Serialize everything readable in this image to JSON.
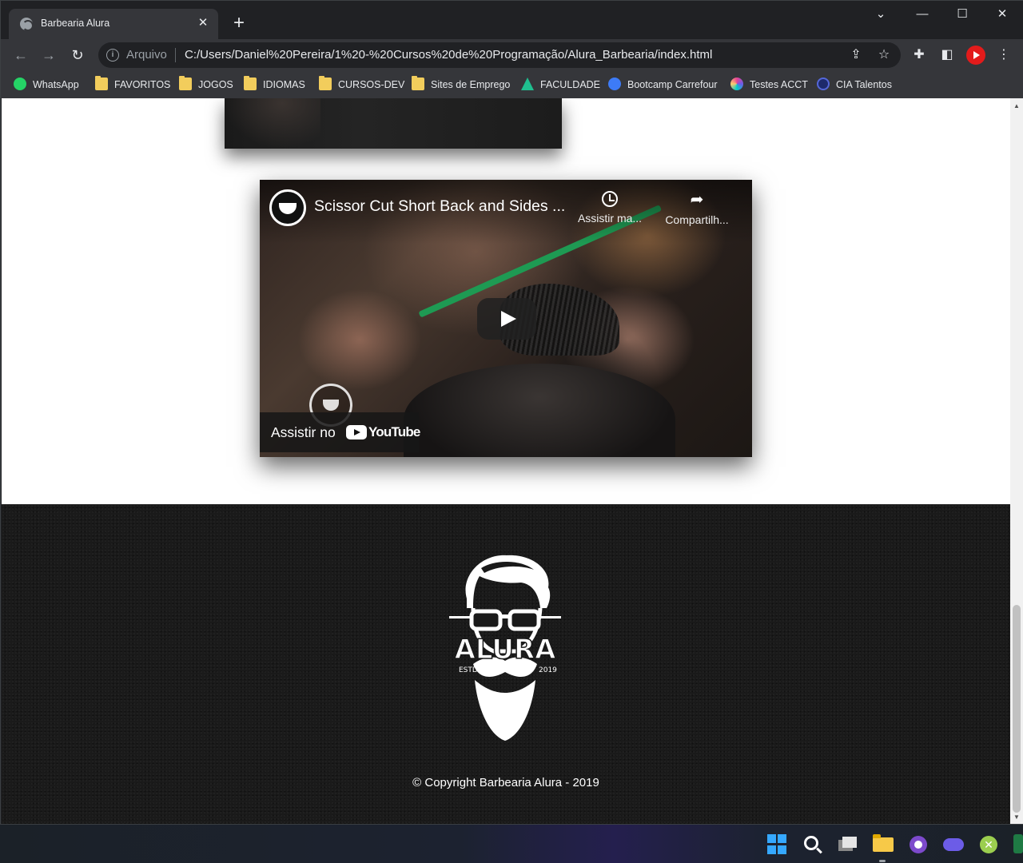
{
  "browser": {
    "tab": {
      "title": "Barbearia Alura",
      "close": "✕",
      "favicon": "globe-icon"
    },
    "new_tab": "+",
    "window_controls": {
      "tab_search": "⌄",
      "minimize": "—",
      "maximize": "☐",
      "close": "✕"
    },
    "nav": {
      "back": "←",
      "forward": "→",
      "reload": "↻"
    },
    "omnibox": {
      "info_icon": "i",
      "protocol_label": "Arquivo",
      "url": "C:/Users/Daniel%20Pereira/1%20-%20Cursos%20de%20Programação/Alura_Barbearia/index.html",
      "share_icon": "⇪",
      "star_icon": "☆"
    },
    "toolbar_icons": {
      "extensions": "✚",
      "side_panel": "◧",
      "menu": "⋮"
    },
    "bookmarks": [
      {
        "label": "WhatsApp",
        "icon": "whatsapp-icon"
      },
      {
        "label": "FAVORITOS",
        "icon": "folder-icon"
      },
      {
        "label": "JOGOS",
        "icon": "folder-icon"
      },
      {
        "label": "IDIOMAS",
        "icon": "folder-icon"
      },
      {
        "label": "CURSOS-DEV",
        "icon": "folder-icon"
      },
      {
        "label": "Sites de Emprego",
        "icon": "folder-icon"
      },
      {
        "label": "FACULDADE",
        "icon": "faculdade-icon"
      },
      {
        "label": "Bootcamp Carrefour",
        "icon": "bootcamp-icon"
      },
      {
        "label": "Testes ACCT",
        "icon": "testes-icon"
      },
      {
        "label": "CIA Talentos",
        "icon": "cia-icon"
      }
    ]
  },
  "page": {
    "video": {
      "title": "Scissor Cut Short Back and Sides ...",
      "watch_later": "Assistir ma...",
      "share": "Compartilh...",
      "watch_on": "Assistir no",
      "youtube": "YouTube"
    },
    "footer": {
      "logo_text": "ALURA",
      "logo_left": "ESTD",
      "logo_right": "2019",
      "copyright": "© Copyright Barbearia Alura - 2019"
    }
  },
  "scrollbar": {
    "up": "▲",
    "down": "▼"
  },
  "taskbar": {
    "icons": [
      "windows-start-icon",
      "search-icon",
      "task-view-icon",
      "file-explorer-icon",
      "github-desktop-icon",
      "game-controller-icon",
      "xbox-icon",
      "excel-icon"
    ]
  }
}
